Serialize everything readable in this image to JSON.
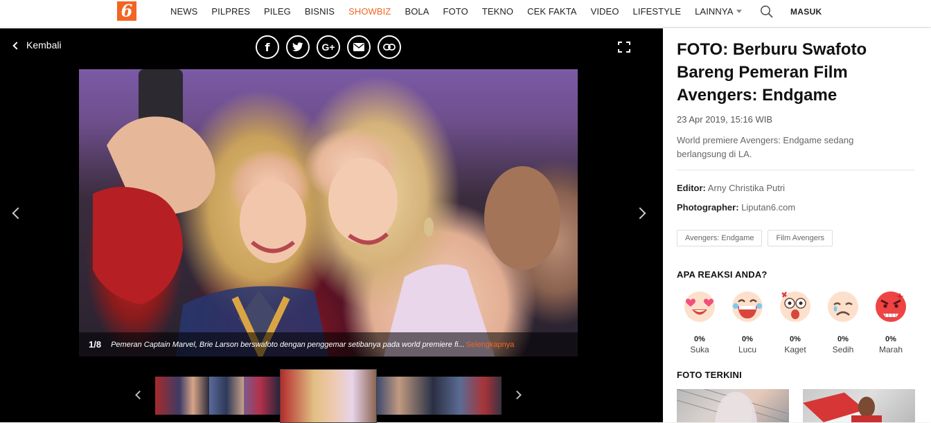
{
  "site": {
    "logo_glyph": "6",
    "brand_color": "#f26522"
  },
  "nav": {
    "items": [
      "NEWS",
      "PILPRES",
      "PILEG",
      "BISNIS",
      "SHOWBIZ",
      "BOLA",
      "FOTO",
      "TEKNO",
      "CEK FAKTA",
      "VIDEO",
      "LIFESTYLE",
      "LAINNYA"
    ],
    "active": "SHOWBIZ",
    "search_icon": "search-icon",
    "login_label": "MASUK"
  },
  "gallery": {
    "back_label": "Kembali",
    "share_icons": [
      "facebook-icon",
      "twitter-icon",
      "google-plus-icon",
      "email-icon",
      "link-icon"
    ],
    "share_glyphs": [
      "f",
      "",
      "G+",
      "",
      ""
    ],
    "counter": "1/8",
    "caption": "Pemeran Captain Marvel, Brie Larson berswafoto dengan penggemar setibanya pada world premiere fi...",
    "more_label": "Selengkapnya"
  },
  "article": {
    "title": "FOTO: Berburu Swafoto Bareng Pemeran Film Avengers: Endgame",
    "date": "23 Apr 2019, 15:16 WIB",
    "summary": "World premiere Avengers: Endgame sedang berlangsung di LA.",
    "editor_label": "Editor:",
    "editor": "Arny Christika Putri",
    "photographer_label": "Photographer:",
    "photographer": "Liputan6.com",
    "tags": [
      "Avengers: Endgame",
      "Film Avengers"
    ]
  },
  "reactions": {
    "heading": "APA REAKSI ANDA?",
    "items": [
      {
        "label": "Suka",
        "percent": "0%",
        "icon": "heart-eyes-icon"
      },
      {
        "label": "Lucu",
        "percent": "0%",
        "icon": "laughing-icon"
      },
      {
        "label": "Kaget",
        "percent": "0%",
        "icon": "surprised-icon"
      },
      {
        "label": "Sedih",
        "percent": "0%",
        "icon": "sad-icon"
      },
      {
        "label": "Marah",
        "percent": "0%",
        "icon": "angry-icon"
      }
    ]
  },
  "latest": {
    "heading": "FOTO TERKINI"
  }
}
